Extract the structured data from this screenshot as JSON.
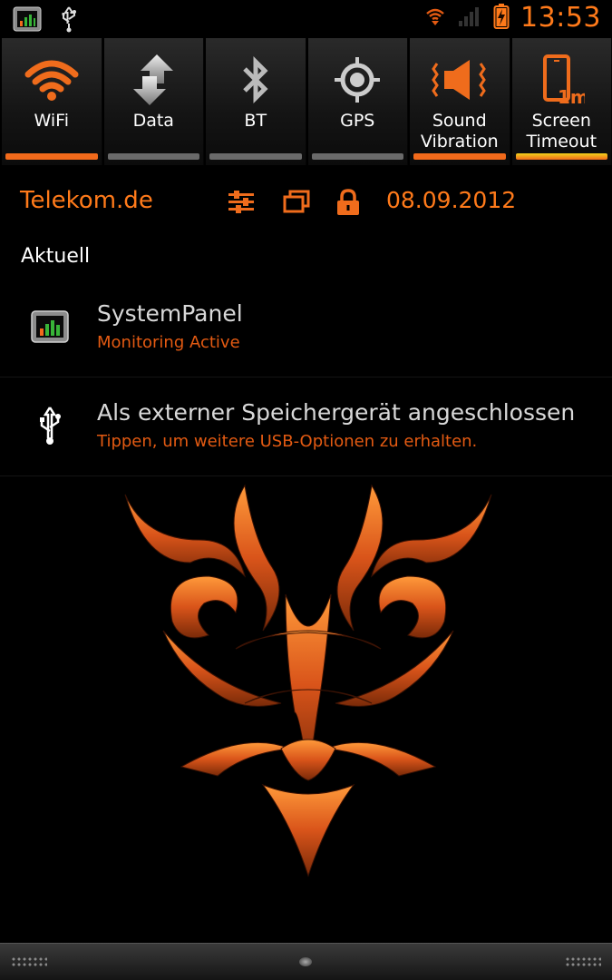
{
  "status_bar": {
    "time": "13:53",
    "left_icons": [
      "systempanel-icon",
      "usb-icon"
    ],
    "right_icons": [
      "wifi-sync-icon",
      "signal-icon",
      "battery-charging-icon"
    ]
  },
  "quick_toggles": [
    {
      "label_lines": [
        "WiFi"
      ],
      "icon": "wifi-icon",
      "state": "on"
    },
    {
      "label_lines": [
        "Data"
      ],
      "icon": "data-icon",
      "state": "off"
    },
    {
      "label_lines": [
        "BT"
      ],
      "icon": "bluetooth-icon",
      "state": "off"
    },
    {
      "label_lines": [
        "GPS"
      ],
      "icon": "gps-icon",
      "state": "off"
    },
    {
      "label_lines": [
        "Sound",
        "Vibration"
      ],
      "icon": "sound-vibration-icon",
      "state": "on"
    },
    {
      "label_lines": [
        "Screen",
        "Timeout"
      ],
      "icon": "screen-timeout-icon",
      "state": "on",
      "timeout_badge": "1m"
    }
  ],
  "carrier_row": {
    "carrier": "Telekom.de",
    "date": "08.09.2012",
    "icons": [
      "settings-sliders-icon",
      "recent-apps-icon",
      "lock-icon"
    ]
  },
  "section_title": "Aktuell",
  "notifications": [
    {
      "title": "SystemPanel",
      "subtitle": "Monitoring Active",
      "icon": "systempanel-icon"
    },
    {
      "title": "Als externer Speichergerät angeschlossen",
      "subtitle": "Tippen, um weitere USB-Optionen zu erhalten.",
      "icon": "usb-icon"
    }
  ],
  "colors": {
    "accent": "#ff7a1a",
    "accent_dark": "#e35a12",
    "bar_on": "#f26a1b",
    "bar_off": "#6a6a6a",
    "bar_yellow": "#f2d21b"
  }
}
